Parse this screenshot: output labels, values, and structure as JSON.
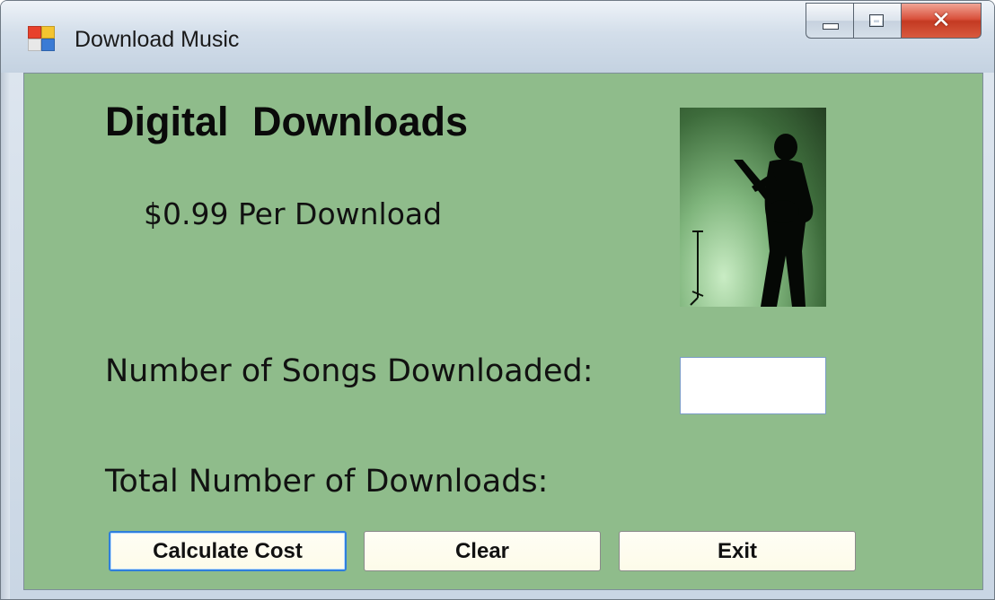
{
  "window": {
    "title": "Download Music",
    "client_bg": "#8fbc8b"
  },
  "form": {
    "heading": "Digital Downloads",
    "price_text": "$0.99 Per Download",
    "songs_label": "Number of Songs Downloaded:",
    "songs_value": "",
    "total_label": "Total Number of Downloads:",
    "image": "guitarist-silhouette-photo"
  },
  "buttons": {
    "calculate": "Calculate Cost",
    "clear": "Clear",
    "exit": "Exit"
  },
  "icons": {
    "app": "app-icon",
    "minimize": "minimize-icon",
    "maximize": "maximize-icon",
    "close": "close-icon"
  }
}
